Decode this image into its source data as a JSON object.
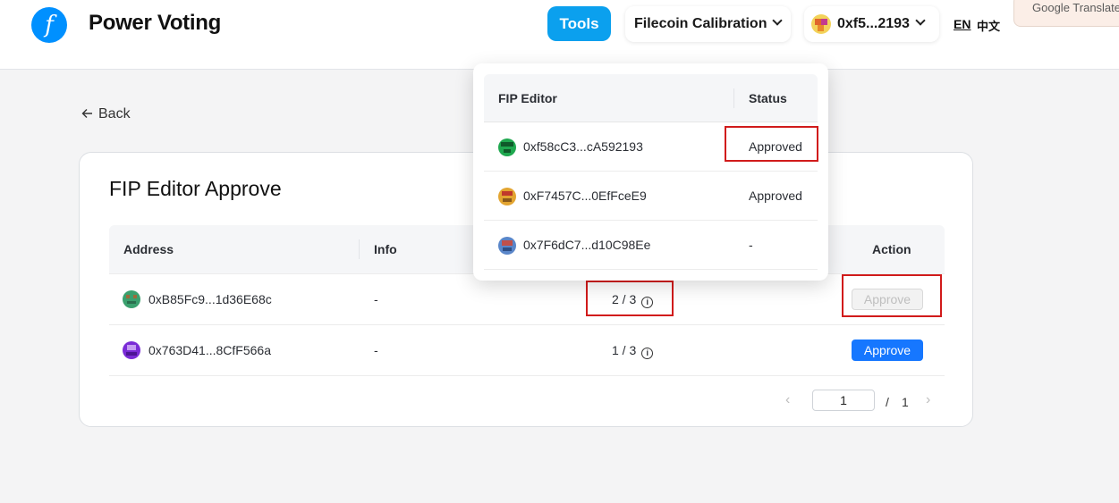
{
  "header": {
    "brand": "Power Voting",
    "logo_glyph": "f",
    "tools_label": "Tools",
    "network": "Filecoin Calibration",
    "wallet": "0xf5...2193",
    "lang_en": "EN",
    "lang_zh": "中文",
    "google_translate": "Google Translate",
    "accent_color": "#0090ff"
  },
  "nav": {
    "back_label": "Back"
  },
  "card": {
    "title": "FIP Editor Approve",
    "columns": [
      "Address",
      "Info",
      "Action"
    ],
    "rows": [
      {
        "address": "0xB85Fc9...1d36E68c",
        "info": "-",
        "votes": "2 / 3",
        "action": "Approve",
        "action_enabled": false
      },
      {
        "address": "0x763D41...8CfF566a",
        "info": "-",
        "votes": "1 / 3",
        "action": "Approve",
        "action_enabled": true
      }
    ],
    "pagination": {
      "current": "1",
      "separator": "/",
      "total": "1"
    }
  },
  "popover": {
    "columns": [
      "FIP Editor",
      "Status"
    ],
    "rows": [
      {
        "editor": "0xf58cC3...cA592193",
        "status": "Approved"
      },
      {
        "editor": "0xF7457C...0EfFceE9",
        "status": "Approved"
      },
      {
        "editor": "0x7F6dC7...d10C98Ee",
        "status": "-"
      }
    ]
  },
  "colors": {
    "primary_button": "#1677ff",
    "tools_button": "#0ba0ee",
    "highlight_box": "#d11b1b"
  }
}
